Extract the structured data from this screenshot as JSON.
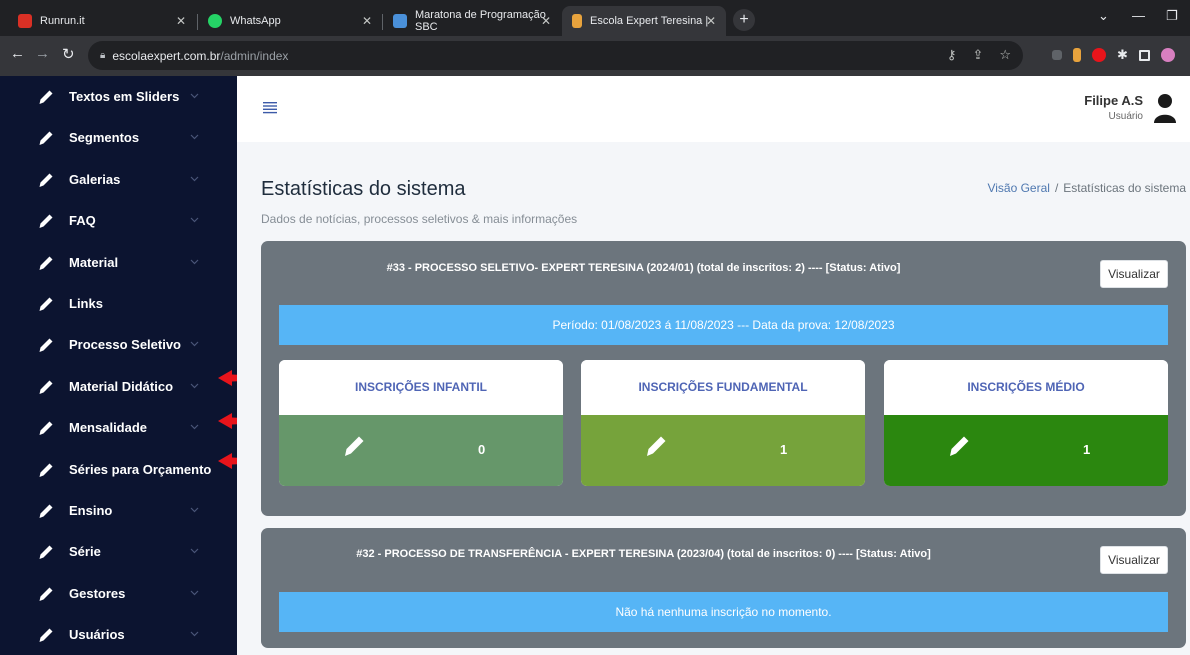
{
  "browser": {
    "tabs": [
      {
        "title": "Runrun.it",
        "favicon_color": "#d93025"
      },
      {
        "title": "WhatsApp",
        "favicon_color": "#25d366"
      },
      {
        "title": "Maratona de Programação SBC",
        "favicon_color": "#4a90d9"
      },
      {
        "title": "Escola Expert Teresina |",
        "favicon_color": "#e8a33d"
      }
    ],
    "url_host": "escolaexpert.com.br",
    "url_path": "/admin/index"
  },
  "sidebar": {
    "items": [
      {
        "label": "Textos em Sliders",
        "has_submenu": true
      },
      {
        "label": "Segmentos",
        "has_submenu": true
      },
      {
        "label": "Galerias",
        "has_submenu": true
      },
      {
        "label": "FAQ",
        "has_submenu": true
      },
      {
        "label": "Material",
        "has_submenu": true
      },
      {
        "label": "Links",
        "has_submenu": false
      },
      {
        "label": "Processo Seletivo",
        "has_submenu": true
      },
      {
        "label": "Material Didático",
        "has_submenu": true
      },
      {
        "label": "Mensalidade",
        "has_submenu": true
      },
      {
        "label": "Séries para Orçamento",
        "has_submenu": false
      },
      {
        "label": "Ensino",
        "has_submenu": true
      },
      {
        "label": "Série",
        "has_submenu": true
      },
      {
        "label": "Gestores",
        "has_submenu": true
      },
      {
        "label": "Usuários",
        "has_submenu": true
      }
    ]
  },
  "user": {
    "name": "Filipe A.S",
    "role": "Usuário"
  },
  "page": {
    "title": "Estatísticas do sistema",
    "subtitle": "Dados de notícias, processos seletivos & mais informações"
  },
  "breadcrumb": {
    "home": "Visão Geral",
    "separator": "/",
    "current": "Estatísticas do sistema"
  },
  "processes": [
    {
      "title": "#33 - PROCESSO SELETIVO- EXPERT TERESINA (2024/01) (total de inscritos: 2) ---- [Status: Ativo]",
      "button": "Visualizar",
      "period": "Período: 01/08/2023 á 11/08/2023 --- Data da prova: 12/08/2023",
      "stats": [
        {
          "label": "INSCRIÇÕES INFANTIL",
          "count": "0",
          "color": "#66976a"
        },
        {
          "label": "INSCRIÇÕES FUNDAMENTAL",
          "count": "1",
          "color": "#76a33b"
        },
        {
          "label": "INSCRIÇÕES MÉDIO",
          "count": "1",
          "color": "#2b870f"
        }
      ]
    },
    {
      "title": "#32 - PROCESSO DE TRANSFERÊNCIA - EXPERT TERESINA (2023/04) (total de inscritos: 0) ---- [Status: Ativo]",
      "button": "Visualizar",
      "message": "Não há nenhuma inscrição no momento."
    }
  ],
  "colors": {
    "sidebar_bg": "#0c1430",
    "card_bg": "#6c757d",
    "info_bar": "#56b5f6",
    "annotation_arrow": "#e8141b"
  }
}
